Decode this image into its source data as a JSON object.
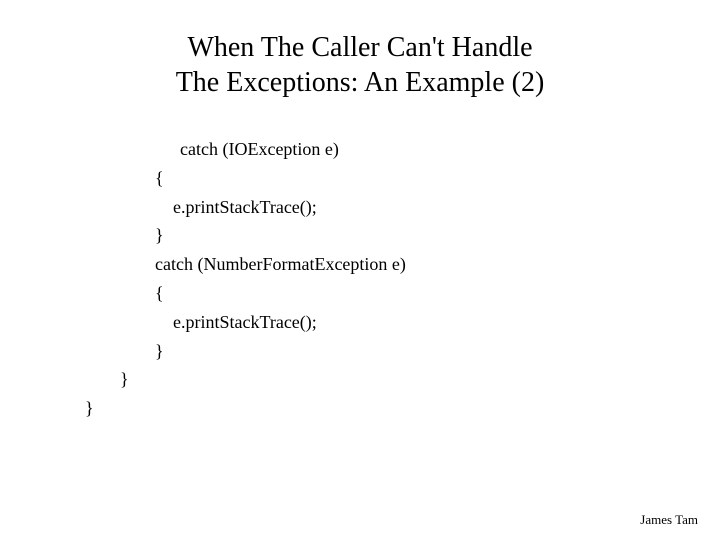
{
  "title_line1": "When The Caller Can't Handle",
  "title_line2": "The Exceptions: An Example (2)",
  "code": {
    "l1": "catch (IOException e)",
    "l2": "{",
    "l3": "e.printStackTrace();",
    "l4": "}",
    "l5": "catch (NumberFormatException e)",
    "l6": "{",
    "l7": "e.printStackTrace();",
    "l8": "}",
    "l9": "}",
    "l10": "}"
  },
  "footer": "James Tam"
}
